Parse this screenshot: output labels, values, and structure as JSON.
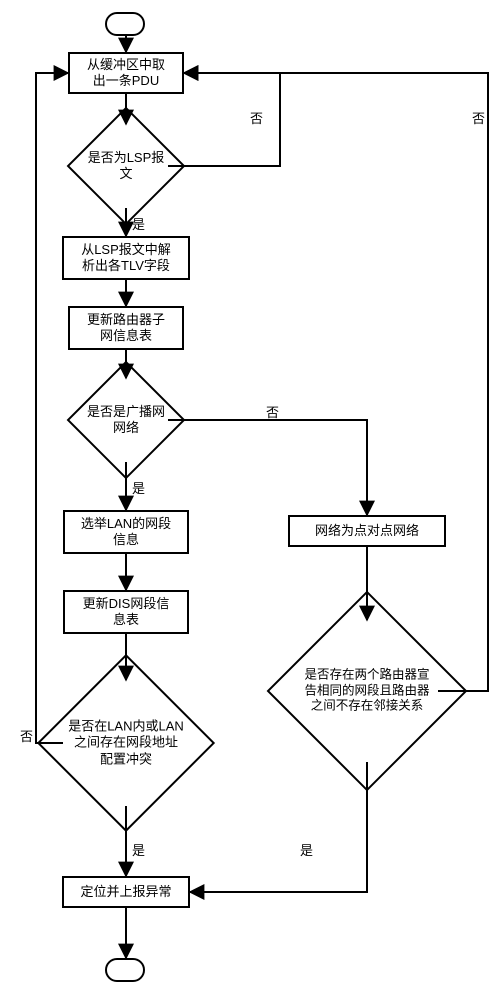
{
  "nodes": {
    "start": "",
    "fetch": "从缓冲区中取\n出一条PDU",
    "isLSP": "是否为LSP报\n文",
    "parseTLV": "从LSP报文中解\n析出各TLV字段",
    "updateSubnet": "更新路由器子\n网信息表",
    "isBroadcast": "是否是广播网\n网络",
    "electLAN": "选举LAN的网段\n信息",
    "updateDIS": "更新DIS网段信\n息表",
    "p2p": "网络为点对点网络",
    "lanConflict": "是否在LAN内或LAN\n之间存在网段地址\n配置冲突",
    "twoRouters": "是否存在两个路由器宣\n告相同的网段且路由器\n之间不存在邻接关系",
    "report": "定位并上报异常",
    "end": ""
  },
  "labels": {
    "yes": "是",
    "no": "否"
  },
  "chart_data": {
    "type": "flowchart",
    "title": "",
    "nodes": [
      {
        "id": "start",
        "type": "terminal",
        "label": ""
      },
      {
        "id": "fetch",
        "type": "process",
        "label": "从缓冲区中取出一条PDU"
      },
      {
        "id": "isLSP",
        "type": "decision",
        "label": "是否为LSP报文"
      },
      {
        "id": "parseTLV",
        "type": "process",
        "label": "从LSP报文中解析出各TLV字段"
      },
      {
        "id": "updateSubnet",
        "type": "process",
        "label": "更新路由器子网信息表"
      },
      {
        "id": "isBroadcast",
        "type": "decision",
        "label": "是否是广播网网络"
      },
      {
        "id": "electLAN",
        "type": "process",
        "label": "选举LAN的网段信息"
      },
      {
        "id": "updateDIS",
        "type": "process",
        "label": "更新DIS网段信息表"
      },
      {
        "id": "p2p",
        "type": "process",
        "label": "网络为点对点网络"
      },
      {
        "id": "lanConflict",
        "type": "decision",
        "label": "是否在LAN内或LAN之间存在网段地址配置冲突"
      },
      {
        "id": "twoRouters",
        "type": "decision",
        "label": "是否存在两个路由器宣告相同的网段且路由器之间不存在邻接关系"
      },
      {
        "id": "report",
        "type": "process",
        "label": "定位并上报异常"
      },
      {
        "id": "end",
        "type": "terminal",
        "label": ""
      }
    ],
    "edges": [
      {
        "from": "start",
        "to": "fetch"
      },
      {
        "from": "fetch",
        "to": "isLSP"
      },
      {
        "from": "isLSP",
        "to": "parseTLV",
        "label": "是"
      },
      {
        "from": "isLSP",
        "to": "fetch",
        "label": "否"
      },
      {
        "from": "parseTLV",
        "to": "updateSubnet"
      },
      {
        "from": "updateSubnet",
        "to": "isBroadcast"
      },
      {
        "from": "isBroadcast",
        "to": "electLAN",
        "label": "是"
      },
      {
        "from": "isBroadcast",
        "to": "p2p",
        "label": "否"
      },
      {
        "from": "electLAN",
        "to": "updateDIS"
      },
      {
        "from": "updateDIS",
        "to": "lanConflict"
      },
      {
        "from": "p2p",
        "to": "twoRouters"
      },
      {
        "from": "lanConflict",
        "to": "report",
        "label": "是"
      },
      {
        "from": "lanConflict",
        "to": "fetch",
        "label": "否"
      },
      {
        "from": "twoRouters",
        "to": "report",
        "label": "是"
      },
      {
        "from": "twoRouters",
        "to": "fetch",
        "label": "否"
      },
      {
        "from": "report",
        "to": "end"
      }
    ]
  }
}
